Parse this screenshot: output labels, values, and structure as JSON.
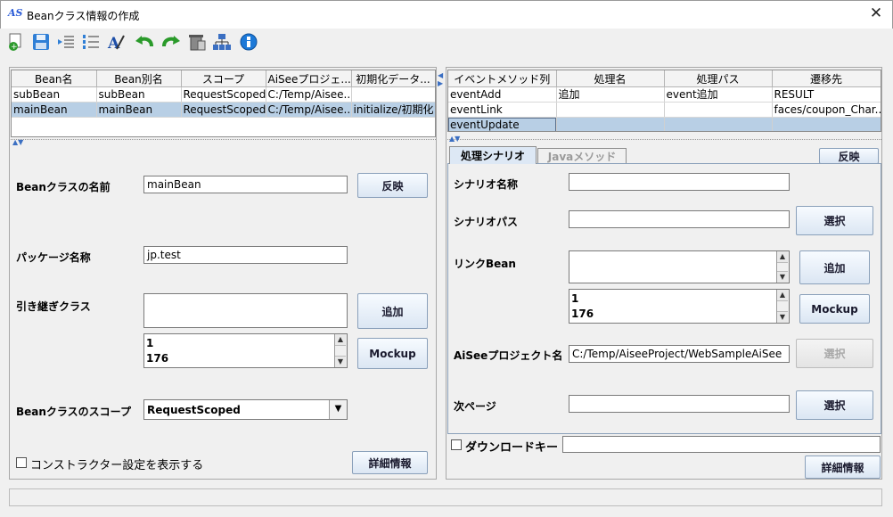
{
  "window": {
    "title": "Beanクラス情報の作成",
    "app_icon_text": "AS",
    "close_glyph": "✕"
  },
  "toolbar": {
    "icons": [
      "add-page-icon",
      "save-icon",
      "indent-icon",
      "list-icon",
      "font-edit-icon",
      "undo-icon",
      "redo-icon",
      "delete-icon",
      "hierarchy-icon",
      "info-icon"
    ]
  },
  "bean_table": {
    "columns": [
      "Bean名",
      "Bean別名",
      "スコープ",
      "AiSeeプロジェ...",
      "初期化データ..."
    ],
    "rows": [
      [
        "subBean",
        "subBean",
        "RequestScoped",
        "C:/Temp/Aisee...",
        ""
      ],
      [
        "mainBean",
        "mainBean",
        "RequestScoped",
        "C:/Temp/Aisee...",
        "initialize/初期化"
      ]
    ],
    "selected_row": 1
  },
  "left_form": {
    "class_name_label": "Beanクラスの名前",
    "class_name_value": "mainBean",
    "reflect_button": "反映",
    "package_label": "パッケージ名称",
    "package_value": "jp.test",
    "inherit_label": "引き継ぎクラス",
    "add_button": "追加",
    "list_values": [
      "1",
      "176"
    ],
    "mockup_button": "Mockup",
    "scope_label": "Beanクラスのスコープ",
    "scope_value": "RequestScoped",
    "constructor_checkbox_label": "コンストラクター設定を表示する",
    "detail_button": "詳細情報"
  },
  "event_table": {
    "columns": [
      "イベントメソッド列",
      "処理名",
      "処理パス",
      "遷移先"
    ],
    "rows": [
      [
        "eventAdd",
        "追加",
        "event追加",
        "RESULT"
      ],
      [
        "eventLink",
        "",
        "",
        "faces/coupon_Char..."
      ],
      [
        "eventUpdate",
        "",
        "",
        ""
      ]
    ],
    "selected_row": 2
  },
  "right_form": {
    "tabs": [
      "処理シナリオ",
      "Javaメソッド"
    ],
    "reflect_button": "反映",
    "scenario_name_label": "シナリオ名称",
    "scenario_name_value": "",
    "scenario_path_label": "シナリオパス",
    "scenario_path_value": "",
    "select_button": "選択",
    "link_bean_label": "リンクBean",
    "add_button": "追加",
    "list_values": [
      "1",
      "176"
    ],
    "mockup_button": "Mockup",
    "project_label": "AiSeeプロジェクト名",
    "project_value": "C:/Temp/AiseeProject/WebSampleAiSee",
    "next_page_label": "次ページ",
    "next_page_value": "",
    "download_key_label": "ダウンロードキー",
    "download_key_value": "",
    "detail_button": "詳細情報"
  },
  "status_bar": {
    "text": ""
  }
}
